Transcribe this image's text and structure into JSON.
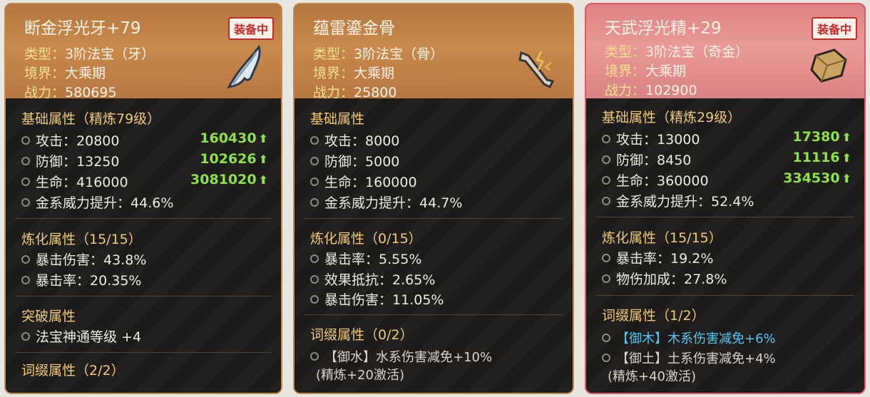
{
  "cards": [
    {
      "title": "断金浮光牙+79",
      "equipped_badge": "装备中",
      "type_key": "类型：",
      "type_val": "3阶法宝（牙）",
      "realm_key": "境界：",
      "realm_val": "大乘期",
      "power_key": "战力：",
      "power_val": "580695",
      "icon": "fang-icon",
      "base_title": "基础属性（精炼79级）",
      "base": [
        {
          "label": "攻击：",
          "value": "20800",
          "bonus": "160430"
        },
        {
          "label": "防御：",
          "value": "13250",
          "bonus": "102626"
        },
        {
          "label": "生命：",
          "value": "416000",
          "bonus": "3081020"
        },
        {
          "label": "金系威力提升：",
          "value": "44.6%",
          "bonus": ""
        }
      ],
      "refine_title": "炼化属性（15/15）",
      "refine": [
        {
          "label": "暴击伤害：",
          "value": "43.8%"
        },
        {
          "label": "暴击率：",
          "value": "20.35%"
        }
      ],
      "break_title": "突破属性",
      "break": [
        {
          "label": "法宝神通等级",
          "value": "+4"
        }
      ],
      "affix_title": "词缀属性（2/2）"
    },
    {
      "title": "蕴雷鎏金骨",
      "equipped_badge": "",
      "type_key": "类型：",
      "type_val": "3阶法宝（骨）",
      "realm_key": "境界：",
      "realm_val": "大乘期",
      "power_key": "战力：",
      "power_val": "25800",
      "icon": "bone-icon",
      "base_title": "基础属性",
      "base": [
        {
          "label": "攻击：",
          "value": "8000",
          "bonus": ""
        },
        {
          "label": "防御：",
          "value": "5000",
          "bonus": ""
        },
        {
          "label": "生命：",
          "value": "160000",
          "bonus": ""
        },
        {
          "label": "金系威力提升：",
          "value": "44.7%",
          "bonus": ""
        }
      ],
      "refine_title": "炼化属性（0/15）",
      "refine": [
        {
          "label": "暴击率：",
          "value": "5.55%"
        },
        {
          "label": "效果抵抗：",
          "value": "2.65%"
        },
        {
          "label": "暴击伤害：",
          "value": "11.05%"
        }
      ],
      "affix_title": "词缀属性（0/2）",
      "affix": [
        {
          "text": "【御水】水系伤害减免+10%",
          "sub": "(精炼+20激活)"
        }
      ]
    },
    {
      "title": "天武浮光精+29",
      "equipped_badge": "装备中",
      "type_key": "类型：",
      "type_val": "3阶法宝（奇金）",
      "realm_key": "境界：",
      "realm_val": "大乘期",
      "power_key": "战力：",
      "power_val": "102900",
      "icon": "ore-icon",
      "base_title": "基础属性（精炼29级）",
      "base": [
        {
          "label": "攻击：",
          "value": "13000",
          "bonus": "17380"
        },
        {
          "label": "防御：",
          "value": "8450",
          "bonus": "11116"
        },
        {
          "label": "生命：",
          "value": "360000",
          "bonus": "334530"
        },
        {
          "label": "金系威力提升：",
          "value": "52.4%",
          "bonus": ""
        }
      ],
      "refine_title": "炼化属性（15/15）",
      "refine": [
        {
          "label": "暴击率：",
          "value": "19.2%"
        },
        {
          "label": "物伤加成：",
          "value": "27.8%"
        }
      ],
      "affix_title": "词缀属性（1/2）",
      "affix": [
        {
          "text": "【御木】木系伤害减免+6%",
          "sub": ""
        },
        {
          "text": "【御土】土系伤害减免+4%",
          "sub": "(精炼+40激活)"
        }
      ]
    }
  ],
  "colors": {
    "gold_border": "#c18a4f",
    "red_border": "#e0576a",
    "bonus_green": "#8ee14a",
    "section_gold": "#efc978",
    "active_affix": "#55c4f0"
  }
}
